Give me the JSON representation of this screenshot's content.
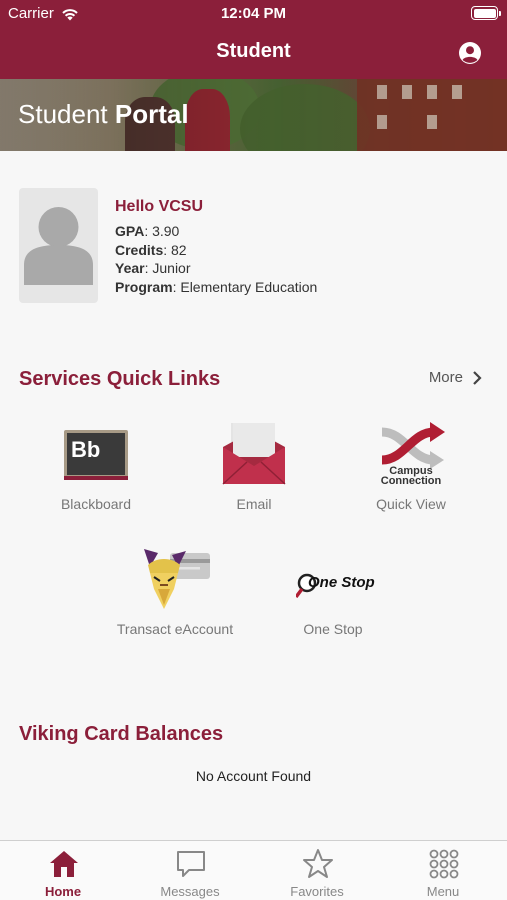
{
  "status_bar": {
    "carrier": "Carrier",
    "time": "12:04 PM"
  },
  "header": {
    "title": "Student"
  },
  "banner": {
    "title_regular": "Student ",
    "title_bold": "Portal"
  },
  "profile": {
    "greeting": "Hello VCSU",
    "fields": [
      {
        "label": "GPA",
        "value": ": 3.90"
      },
      {
        "label": "Credits",
        "value": ": 82"
      },
      {
        "label": "Year",
        "value": ": Junior"
      },
      {
        "label": "Program",
        "value": ": Elementary Education"
      }
    ]
  },
  "services": {
    "title": "Services Quick Links",
    "more_label": "More",
    "links": [
      {
        "label": "Blackboard",
        "icon": "blackboard-icon",
        "icon_text": "Bb"
      },
      {
        "label": "Email",
        "icon": "email-envelope-icon"
      },
      {
        "label": "Quick View",
        "icon": "campus-connection-icon",
        "icon_text_line1": "Campus",
        "icon_text_line2": "Connection"
      },
      {
        "label": "Transact eAccount",
        "icon": "viking-card-icon"
      },
      {
        "label": "One Stop",
        "icon": "one-stop-icon",
        "icon_text": "One Stop"
      }
    ]
  },
  "balances": {
    "title": "Viking Card Balances",
    "empty_message": "No Account Found"
  },
  "tabbar": {
    "tabs": [
      {
        "label": "Home",
        "icon": "home-icon",
        "active": true
      },
      {
        "label": "Messages",
        "icon": "message-bubble-icon",
        "active": false
      },
      {
        "label": "Favorites",
        "icon": "star-icon",
        "active": false
      },
      {
        "label": "Menu",
        "icon": "grid-menu-icon",
        "active": false
      }
    ]
  },
  "colors": {
    "brand": "#8b1f3a",
    "background": "#f7f7f7",
    "muted_text": "#777777"
  }
}
